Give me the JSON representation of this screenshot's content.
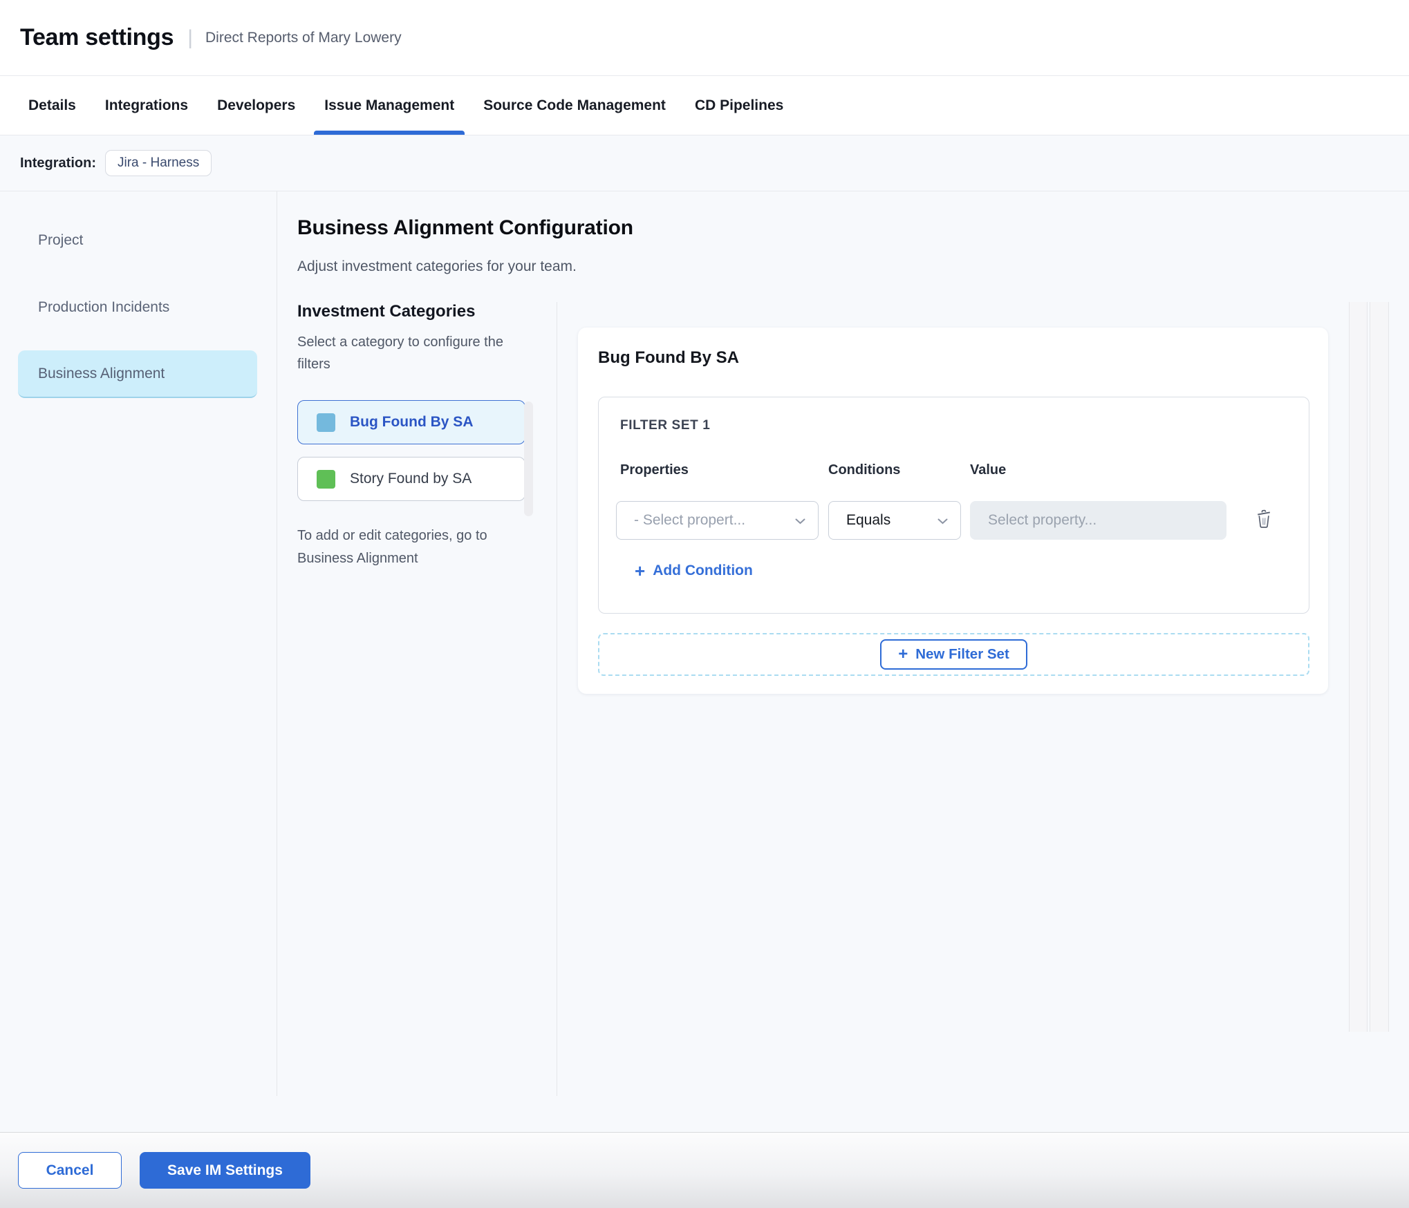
{
  "header": {
    "title": "Team settings",
    "separator": "|",
    "subtitle": "Direct Reports of Mary Lowery"
  },
  "tabs": [
    {
      "label": "Details",
      "active": false
    },
    {
      "label": "Integrations",
      "active": false
    },
    {
      "label": "Developers",
      "active": false
    },
    {
      "label": "Issue Management",
      "active": true
    },
    {
      "label": "Source Code Management",
      "active": false
    },
    {
      "label": "CD Pipelines",
      "active": false
    }
  ],
  "integration": {
    "label": "Integration:",
    "chip": "Jira - Harness"
  },
  "sidebar": {
    "items": [
      {
        "label": "Project",
        "active": false
      },
      {
        "label": "Production Incidents",
        "active": false
      },
      {
        "label": "Business Alignment",
        "active": true
      }
    ]
  },
  "main": {
    "title": "Business Alignment Configuration",
    "subtitle": "Adjust investment categories for your team.",
    "categories": {
      "title": "Investment Categories",
      "hint": "Select a category to configure the filters",
      "items": [
        {
          "label": "Bug Found By SA",
          "color": "#74b9dd",
          "selected": true
        },
        {
          "label": "Story Found by SA",
          "color": "#5fbf56",
          "selected": false
        }
      ],
      "footnote": "To add or edit categories, go to Business Alignment"
    },
    "filter_panel": {
      "title": "Bug Found By SA",
      "filter_set": {
        "title": "FILTER SET 1",
        "columns": {
          "properties": "Properties",
          "conditions": "Conditions",
          "value": "Value"
        },
        "property_placeholder": "- Select propert...",
        "condition_selected": "Equals",
        "value_placeholder": "Select property...",
        "add_condition_label": "Add Condition"
      },
      "new_filter_set_label": "New Filter Set"
    }
  },
  "footer": {
    "cancel_label": "Cancel",
    "save_label": "Save IM Settings"
  },
  "icons": {
    "plus_glyph": "+"
  },
  "colors": {
    "accent_blue": "#2e6bd6",
    "active_tab_underline": "#2e6bd6",
    "sidebar_active_bg": "#cdeefb",
    "category_selected_bg": "#e8f5fc",
    "category_selected_border": "#3f71d3",
    "bug_category_swatch": "#74b9dd",
    "story_category_swatch": "#5fbf56",
    "dashed_zone_border": "#aadcf1",
    "value_input_bg": "#e9edf1"
  }
}
